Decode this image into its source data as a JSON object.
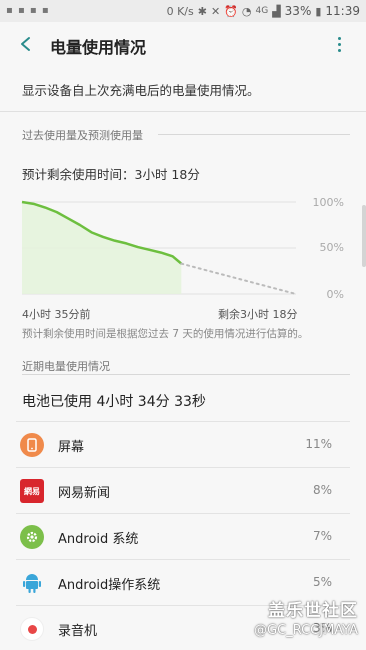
{
  "status_bar": {
    "speed": "0 K/s",
    "network": "4G",
    "battery_pct": "33%",
    "time": "11:39"
  },
  "header": {
    "title": "电量使用情况"
  },
  "description": "显示设备自上次充满电后的电量使用情况。",
  "history_section": {
    "title": "过去使用量及预测使用量",
    "remaining_text": "预计剩余使用时间：3小时 18分"
  },
  "chart_data": {
    "type": "area",
    "y_ticks": [
      "100%",
      "50%",
      "0%"
    ],
    "ylim": [
      0,
      100
    ],
    "x_start_label": "4小时 35分前",
    "x_end_label": "剩余3小时 18分",
    "actual": {
      "x_minutes": [
        0,
        20,
        40,
        60,
        80,
        100,
        120,
        140,
        160,
        180,
        200,
        220,
        240,
        260,
        275
      ],
      "battery_pct": [
        100,
        98,
        94,
        89,
        82,
        75,
        67,
        62,
        58,
        55,
        51,
        48,
        45,
        41,
        33
      ]
    },
    "predicted": {
      "x_minutes": [
        275,
        473
      ],
      "battery_pct": [
        33,
        0
      ]
    },
    "colors": {
      "line": "#6dbf3f",
      "fill": "#e4f3dc",
      "predicted": "#bbbbbb",
      "grid": "#e2e2e2"
    }
  },
  "note": "预计剩余使用时间是根据您过去 7 天的使用情况进行估算的。",
  "recent_section": {
    "title": "近期电量使用情况",
    "total": "电池已使用 4小时 34分 33秒"
  },
  "apps": [
    {
      "name": "屏幕",
      "pct": "11%",
      "icon": "screen-icon",
      "color": "#f08a4b"
    },
    {
      "name": "网易新闻",
      "pct": "8%",
      "icon": "netease-news-icon",
      "color": "#d8262d",
      "icon_text": "網易"
    },
    {
      "name": "Android 系统",
      "pct": "7%",
      "icon": "gear-icon",
      "color": "#7cbf4a"
    },
    {
      "name": "Android操作系统",
      "pct": "5%",
      "icon": "android-icon",
      "color": "#3aa6d9"
    },
    {
      "name": "录音机",
      "pct": "3%",
      "icon": "recorder-icon",
      "color": "#e84747"
    }
  ],
  "watermark": {
    "line1": "盖乐世社区",
    "line2": "@GC_RCCJMAYA"
  }
}
